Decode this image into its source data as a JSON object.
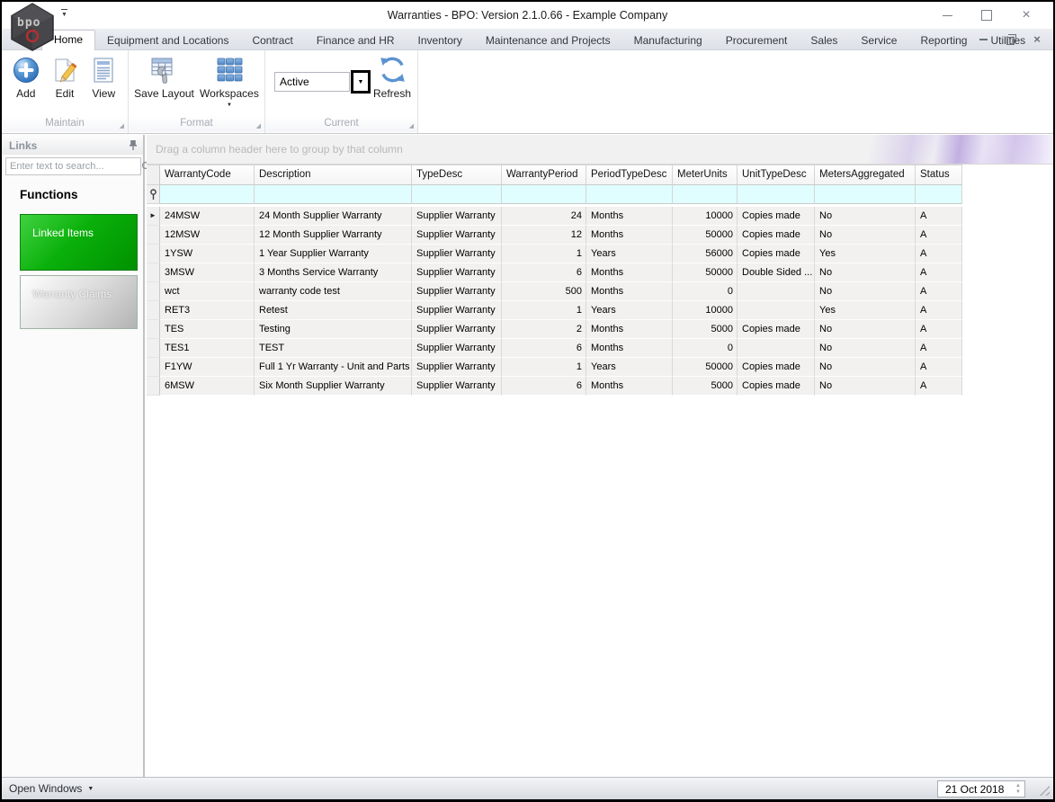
{
  "window": {
    "title": "Warranties - BPO: Version 2.1.0.66 - Example Company",
    "logo_text": "bpo"
  },
  "tabs": [
    "Home",
    "Equipment and Locations",
    "Contract",
    "Finance and HR",
    "Inventory",
    "Maintenance and Projects",
    "Manufacturing",
    "Procurement",
    "Sales",
    "Service",
    "Reporting",
    "Utilities"
  ],
  "active_tab": "Home",
  "ribbon": {
    "groups": [
      {
        "caption": "Maintain",
        "buttons": [
          {
            "label": "Add"
          },
          {
            "label": "Edit"
          },
          {
            "label": "View"
          }
        ]
      },
      {
        "caption": "Format",
        "buttons": [
          {
            "label": "Save Layout"
          },
          {
            "label": "Workspaces"
          }
        ]
      },
      {
        "caption": "Current",
        "combo_value": "Active",
        "buttons": [
          {
            "label": "Refresh"
          }
        ]
      }
    ]
  },
  "sidebar": {
    "panel_title": "Links",
    "search_placeholder": "Enter text to search...",
    "section_title": "Functions",
    "buttons": [
      {
        "label": "Linked Items",
        "style": "green"
      },
      {
        "label": "Warranty Claims",
        "style": "silver"
      }
    ]
  },
  "grid": {
    "group_by_hint": "Drag a column header here to group by that column",
    "columns": [
      {
        "label": "WarrantyCode",
        "width": 105,
        "align": "left"
      },
      {
        "label": "Description",
        "width": 175,
        "align": "left"
      },
      {
        "label": "TypeDesc",
        "width": 100,
        "align": "left"
      },
      {
        "label": "WarrantyPeriod",
        "width": 94,
        "align": "right"
      },
      {
        "label": "PeriodTypeDesc",
        "width": 96,
        "align": "left"
      },
      {
        "label": "MeterUnits",
        "width": 72,
        "align": "right"
      },
      {
        "label": "UnitTypeDesc",
        "width": 86,
        "align": "left"
      },
      {
        "label": "MetersAggregated",
        "width": 112,
        "align": "left"
      },
      {
        "label": "Status",
        "width": 52,
        "align": "left"
      }
    ],
    "rows": [
      [
        "24MSW",
        "24 Month Supplier Warranty",
        "Supplier Warranty",
        "24",
        "Months",
        "10000",
        "Copies made",
        "No",
        "A"
      ],
      [
        "12MSW",
        "12 Month Supplier Warranty",
        "Supplier Warranty",
        "12",
        "Months",
        "50000",
        "Copies made",
        "No",
        "A"
      ],
      [
        "1YSW",
        "1 Year Supplier Warranty",
        "Supplier Warranty",
        "1",
        "Years",
        "56000",
        "Copies made",
        "Yes",
        "A"
      ],
      [
        "3MSW",
        "3 Months Service Warranty",
        "Supplier Warranty",
        "6",
        "Months",
        "50000",
        "Double Sided ...",
        "No",
        "A"
      ],
      [
        "wct",
        "warranty code test",
        "Supplier Warranty",
        "500",
        "Months",
        "0",
        "",
        "No",
        "A"
      ],
      [
        "RET3",
        "Retest",
        "Supplier Warranty",
        "1",
        "Years",
        "10000",
        "",
        "Yes",
        "A"
      ],
      [
        "TES",
        "Testing",
        "Supplier Warranty",
        "2",
        "Months",
        "5000",
        "Copies made",
        "No",
        "A"
      ],
      [
        "TES1",
        "TEST",
        "Supplier Warranty",
        "6",
        "Months",
        "0",
        "",
        "No",
        "A"
      ],
      [
        "F1YW",
        "Full 1 Yr Warranty - Unit and Parts",
        "Supplier Warranty",
        "1",
        "Years",
        "50000",
        "Copies made",
        "No",
        "A"
      ],
      [
        "6MSW",
        "Six Month Supplier Warranty",
        "Supplier Warranty",
        "6",
        "Months",
        "5000",
        "Copies made",
        "No",
        "A"
      ]
    ],
    "current_row_index": 0
  },
  "statusbar": {
    "open_windows_label": "Open Windows",
    "date_value": "21 Oct 2018"
  },
  "icons": {
    "dropdown_arrow": "▼",
    "spin_up": "▲",
    "spin_down": "▼",
    "close": "×",
    "row_indicator_arrow": "►",
    "group_corner": "◢"
  },
  "colors": {
    "filter_row_bg": "#e0feff",
    "row_bg": "#f2f1ef",
    "green_button": "#0ab00a",
    "accent_blue": "#5b93d0",
    "swirl_purple": "#b9a5dd"
  }
}
